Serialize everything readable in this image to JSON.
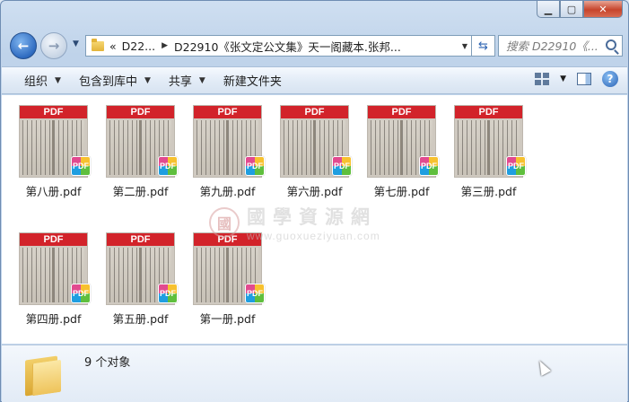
{
  "window": {
    "caption_buttons": {
      "minimize": "▁",
      "maximize": "▢",
      "close": "✕"
    }
  },
  "nav": {
    "back_glyph": "←",
    "forward_glyph": "→",
    "history_glyph": "▼",
    "address": {
      "overflow": "«",
      "segment_1": "D22...",
      "separator": "▶",
      "segment_2": "D22910《张文定公文集》天一阁藏本.张邦...",
      "dropdown": "▼"
    },
    "refresh_glyph": "⇆",
    "search": {
      "placeholder": "搜索 D22910《..."
    }
  },
  "toolbar": {
    "items": [
      {
        "label": "组织",
        "arrow": "▼"
      },
      {
        "label": "包含到库中",
        "arrow": "▼"
      },
      {
        "label": "共享",
        "arrow": "▼"
      },
      {
        "label": "新建文件夹",
        "arrow": ""
      }
    ],
    "view_arrow": "▼",
    "help": "?"
  },
  "files": [
    {
      "name": "第八册.pdf",
      "band": "PDF",
      "badge": "PDF"
    },
    {
      "name": "第二册.pdf",
      "band": "PDF",
      "badge": "PDF"
    },
    {
      "name": "第九册.pdf",
      "band": "PDF",
      "badge": "PDF"
    },
    {
      "name": "第六册.pdf",
      "band": "PDF",
      "badge": "PDF"
    },
    {
      "name": "第七册.pdf",
      "band": "PDF",
      "badge": "PDF"
    },
    {
      "name": "第三册.pdf",
      "band": "PDF",
      "badge": "PDF"
    },
    {
      "name": "第四册.pdf",
      "band": "PDF",
      "badge": "PDF"
    },
    {
      "name": "第五册.pdf",
      "band": "PDF",
      "badge": "PDF"
    },
    {
      "name": "第一册.pdf",
      "band": "PDF",
      "badge": "PDF"
    }
  ],
  "watermark": {
    "seal": "國",
    "text": "國學資源網",
    "url": "www.guoxueziyuan.com"
  },
  "details": {
    "count": "9 个对象"
  },
  "colors": {
    "pdf_band": "#d2232a",
    "window_frame": "#bfd3ea",
    "close_button": "#c7442c"
  }
}
